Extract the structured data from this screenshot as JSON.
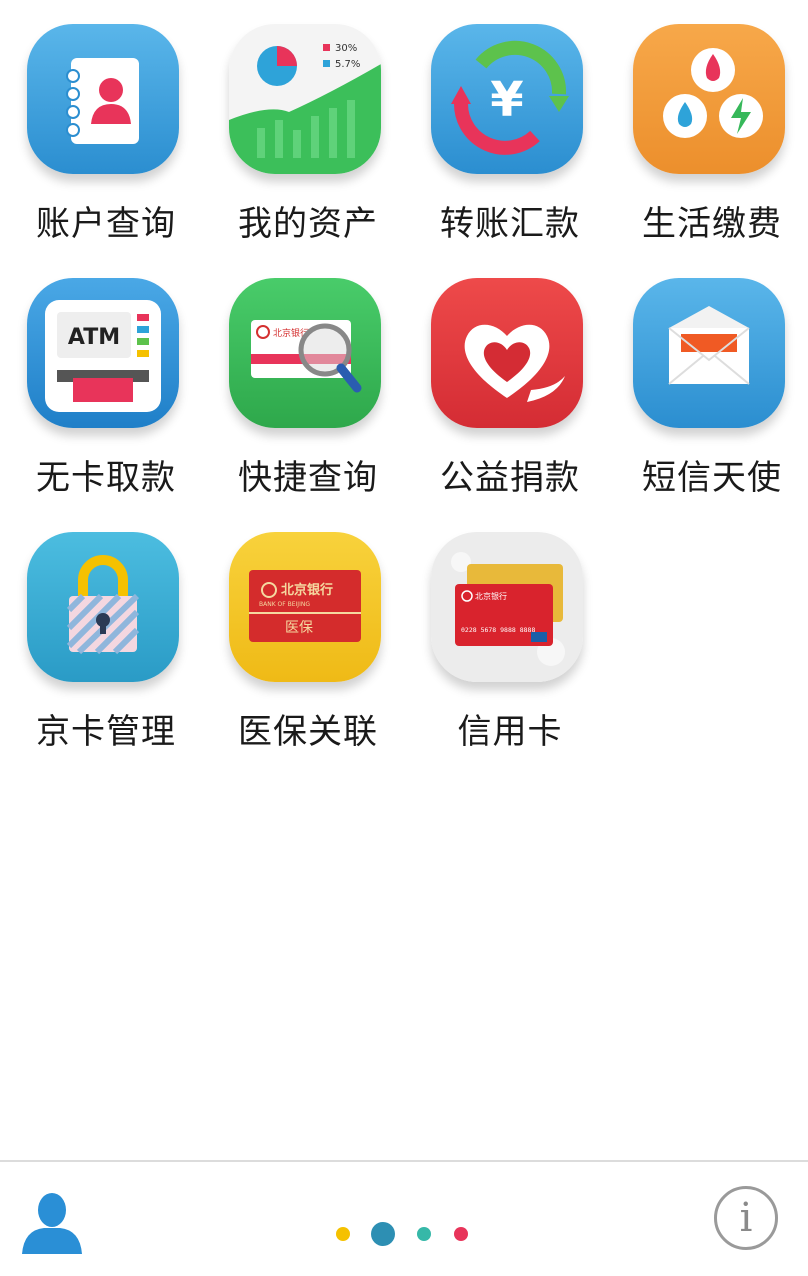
{
  "tiles": [
    {
      "label": "账户查询",
      "icon": "contact-book-icon"
    },
    {
      "label": "我的资产",
      "icon": "asset-chart-icon"
    },
    {
      "label": "转账汇款",
      "icon": "yen-transfer-icon"
    },
    {
      "label": "生活缴费",
      "icon": "utilities-icon"
    },
    {
      "label": "无卡取款",
      "icon": "atm-icon"
    },
    {
      "label": "快捷查询",
      "icon": "card-magnifier-icon"
    },
    {
      "label": "公益捐款",
      "icon": "heart-icon"
    },
    {
      "label": "短信天使",
      "icon": "envelope-icon"
    },
    {
      "label": "京卡管理",
      "icon": "padlock-icon"
    },
    {
      "label": "医保关联",
      "icon": "medical-card-icon"
    },
    {
      "label": "信用卡",
      "icon": "credit-card-icon"
    }
  ],
  "icon_text": {
    "pie_pct_1": "30%",
    "pie_pct_2": "5.7%",
    "atm": "ATM",
    "yen": "¥",
    "medical": "医保",
    "bank_name": "北京银行",
    "bank_name_en": "BANK OF BEIJING",
    "card_number": "0228 5678 9888 8888"
  },
  "pager": {
    "pages": 4,
    "current": 2
  },
  "colors": {
    "accent_blue": "#3aa0dc",
    "pager_yellow": "#f5c100",
    "pager_blue": "#2d8fb3",
    "pager_teal": "#36b8a8",
    "pager_red": "#e8345a"
  },
  "bottom": {
    "profile_icon": "person-icon",
    "info_icon": "info-icon"
  }
}
